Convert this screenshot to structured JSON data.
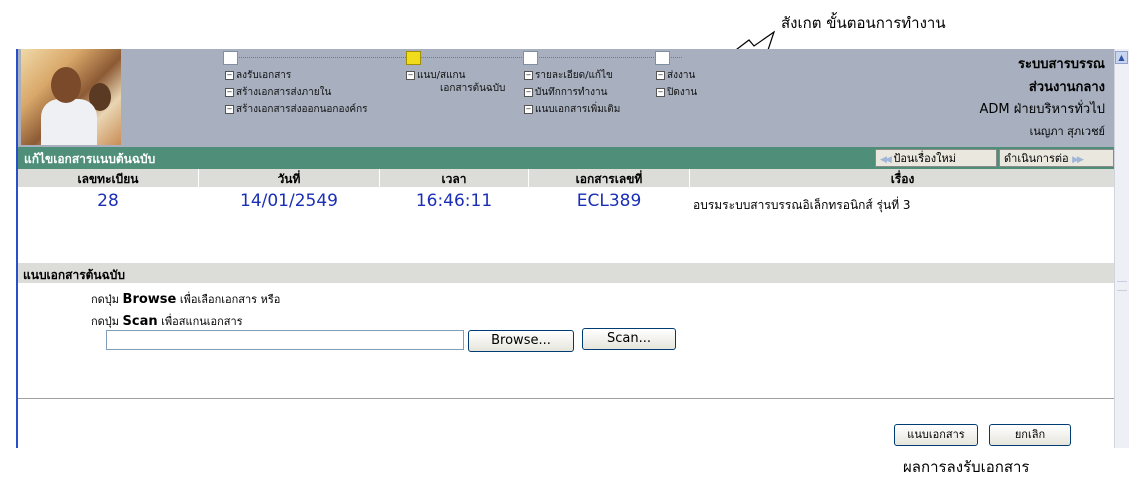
{
  "annotations": {
    "note": "สังเกต ขั้นตอนการทำงาน",
    "caption": "ผลการลงรับเอกสาร"
  },
  "workflow": {
    "col1": [
      "ลงรับเอกสาร",
      "สร้างเอกสารส่งภายใน",
      "สร้างเอกสารส่งออกนอกองค์กร"
    ],
    "col2": [
      "แนบ/สแกน",
      "เอกสารต้นฉบับ"
    ],
    "col3": [
      "รายละเอียด/แก้ไข",
      "บันทึกการทำงาน",
      "แนบเอกสารเพิ่มเติม"
    ],
    "col4": [
      "ส่งงาน",
      "ปิดงาน"
    ],
    "active_step": 2
  },
  "system": {
    "title": "ระบบสารบรรณ",
    "subtitle": "ส่วนงานกลาง",
    "department": "ADM ฝ่ายบริหารทั่วไป",
    "user": "เนญภา สุภเวชย์"
  },
  "page": {
    "title": "แก้ไขเอกสารแนบต้นฉบับ",
    "nav_new": "ป้อนเรื่องใหม่",
    "nav_next": "ดำเนินการต่อ"
  },
  "table": {
    "headers": [
      "เลขทะเบียน",
      "วันที่",
      "เวลา",
      "เอกสารเลขที่",
      "เรื่อง"
    ],
    "row": [
      "28",
      "14/01/2549",
      "16:46:11",
      "ECL389",
      "อบรมระบบสารบรรณอิเล็กทรอนิกส์ รุ่นที่ 3"
    ]
  },
  "attach": {
    "section_title": "แนบเอกสารต้นฉบับ",
    "line1_prefix": "กดปุ่ม",
    "line1_key": "Browse",
    "line1_suffix": "เพื่อเลือกเอกสาร หรือ",
    "line2_prefix": "กดปุ่ม",
    "line2_key": "Scan",
    "line2_suffix": "เพื่อสแกนเอกสาร",
    "file_value": "",
    "browse_label": "Browse...",
    "scan_label": "Scan..."
  },
  "actions": {
    "attach_label": "แนบเอกสาร",
    "cancel_label": "ยกเลิก"
  },
  "colors": {
    "titlebar": "#4f8f7a",
    "banner": "#a8b0bf",
    "data_text": "#1a2fb5",
    "active_step": "#f0dc1a"
  }
}
